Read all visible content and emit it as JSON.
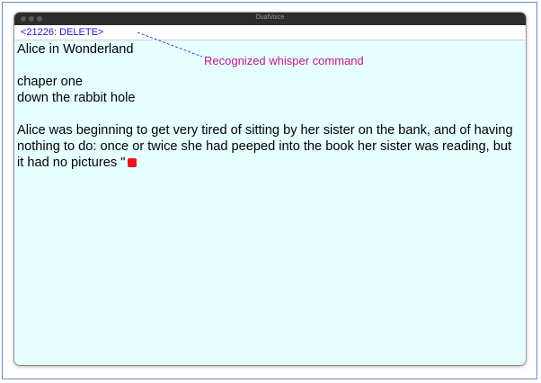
{
  "window": {
    "title": "DualVoice",
    "background": "#e6ffff"
  },
  "command_bar": {
    "command_text": "<21226: DELETE>",
    "color": "#1a17d6"
  },
  "document": {
    "title_line": "Alice in Wonderland",
    "chapter_line": "chaper one",
    "subtitle_line": "down the rabbit hole",
    "paragraph": "Alice was beginning to get very tired of sitting by her sister on the bank, and of having nothing to do: once or twice she had peeped into the book her sister was reading, but it had no pictures  \"",
    "recording_indicator": "stop-square-icon"
  },
  "annotation": {
    "label": "Recognized whisper command",
    "color": "#c6138f"
  }
}
